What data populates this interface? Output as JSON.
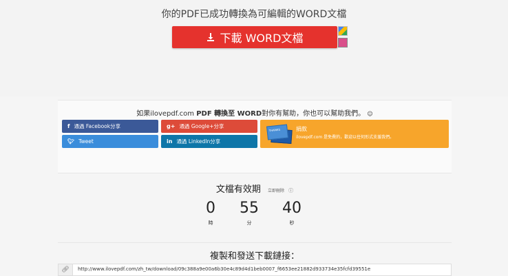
{
  "header": {
    "headline": "你的PDF已成功轉換為可編輯的WORD文檔",
    "download_label": "下載 WORD文檔"
  },
  "share": {
    "title_pre": "如果ilovepdf.com ",
    "title_bold": "PDF 轉換至 WORD",
    "title_post": "對你有幫助，你也可以幫助我們。",
    "buttons": {
      "facebook": "通過 Facebook分享",
      "tweet": "Tweet",
      "google": "通過 Google+分享",
      "linkedin": "通過 LinkedIn分享"
    },
    "donate": {
      "title": "捐款",
      "subtitle": "ilovepdf.com 是免費的，歡迎以任何形式支援我們。",
      "card_label": "THANKS"
    }
  },
  "expiry": {
    "title": "文檔有效期",
    "link": "立即刪除",
    "hours": "0",
    "minutes": "55",
    "seconds": "40",
    "hours_label": "時",
    "minutes_label": "分",
    "seconds_label": "秒"
  },
  "copy": {
    "title": "複製和發送下載鏈接：",
    "url": "http://www.ilovepdf.com/zh_tw/download/09c388a9e00a6b30e4c89d4d1beb0007_f6653ee21882d933734e35fcfd39551e"
  },
  "colors": {
    "download": "#e5322d",
    "facebook": "#3b5998",
    "twitter": "#3a8ddb",
    "google": "#dd4b39",
    "linkedin": "#0e76a8",
    "donate": "#f7a52b"
  },
  "icons": {
    "download": "download-icon",
    "facebook": "facebook-icon",
    "twitter": "twitter-icon",
    "google": "google-plus-icon",
    "linkedin": "linkedin-icon",
    "info": "info-icon",
    "link": "link-icon"
  }
}
